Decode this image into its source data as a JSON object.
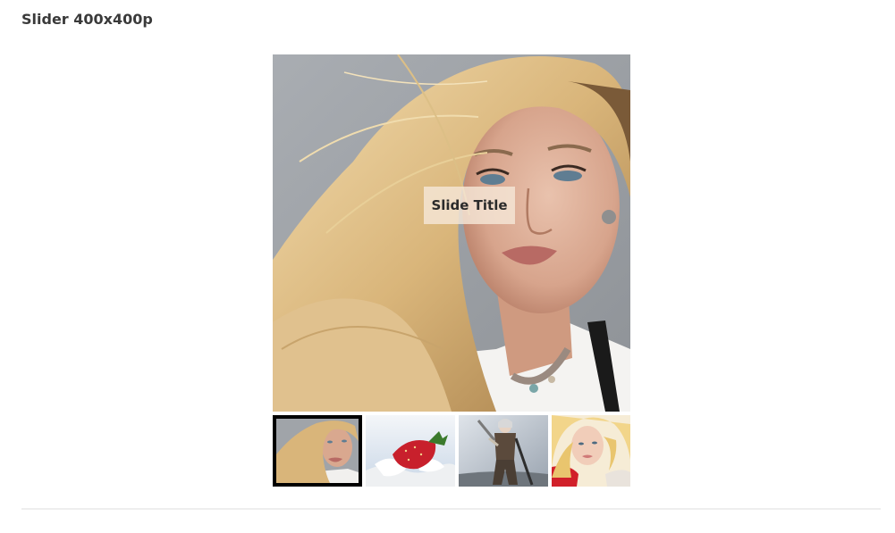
{
  "page": {
    "heading": "Slider 400x400p"
  },
  "slider": {
    "active_index": 0,
    "slides": [
      {
        "title": "Slide Title",
        "image": "portrait-blonde-windswept-hair"
      },
      {
        "image": "strawberry-milk-splash"
      },
      {
        "image": "warrior-woman-armor"
      },
      {
        "image": "blonde-woman-red-top"
      }
    ]
  },
  "colors": {
    "active_thumb_border": "#000000",
    "title_background": "#f5e6d7",
    "divider": "#eeeeee"
  }
}
